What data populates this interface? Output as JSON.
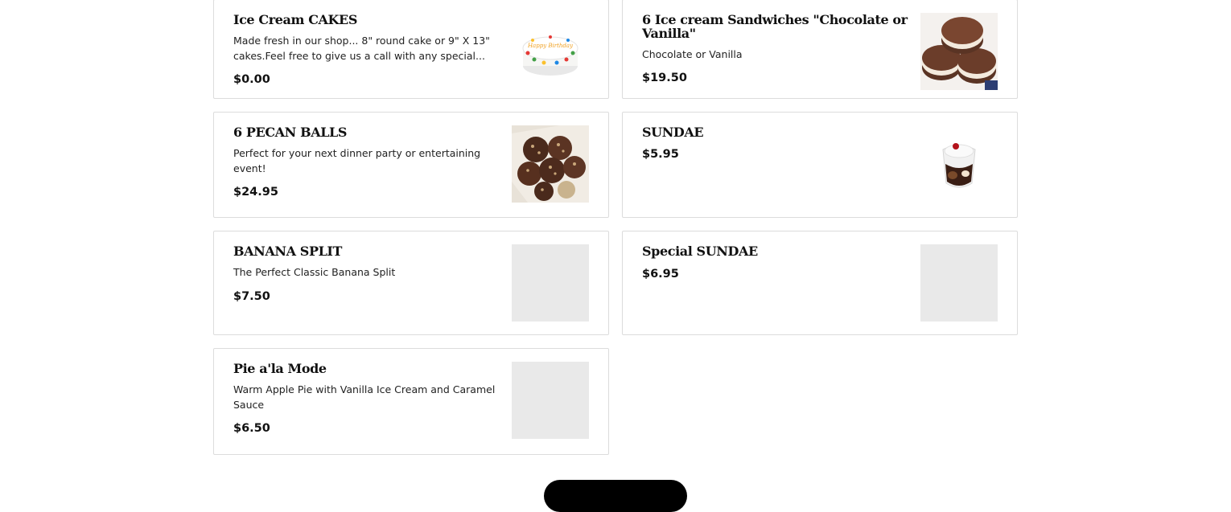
{
  "menu_items": [
    {
      "title": "Ice Cream CAKES",
      "description": "Made fresh in our shop... 8\" round cake or 9\" X 13\" cakes.Feel free to give us a call with any special...",
      "price": "$0.00",
      "image": "birthday-cake-photo",
      "image_text": "Happy Birthday"
    },
    {
      "title": "6 Ice cream Sandwiches \"Chocolate or Vanilla\"",
      "description": "Chocolate or Vanilla",
      "price": "$19.50",
      "image": "ice-cream-sandwich-photo"
    },
    {
      "title": "6 PECAN BALLS",
      "description": "Perfect for your next dinner party or entertaining event!",
      "price": "$24.95",
      "image": "pecan-balls-photo"
    },
    {
      "title": "SUNDAE",
      "description": "",
      "price": "$5.95",
      "image": "sundae-cup-photo"
    },
    {
      "title": "BANANA SPLIT",
      "description": "The Perfect Classic Banana Split",
      "price": "$7.50",
      "image": "image-placeholder"
    },
    {
      "title": "Special SUNDAE",
      "description": "",
      "price": "$6.95",
      "image": "image-placeholder"
    },
    {
      "title": "Pie a'la Mode",
      "description": "Warm Apple Pie with Vanilla Ice Cream and Caramel Sauce",
      "price": "$6.50",
      "image": "image-placeholder"
    }
  ],
  "colors": {
    "card_border": "#dcdcdc",
    "placeholder": "#e9e9e9",
    "button": "#000000"
  }
}
